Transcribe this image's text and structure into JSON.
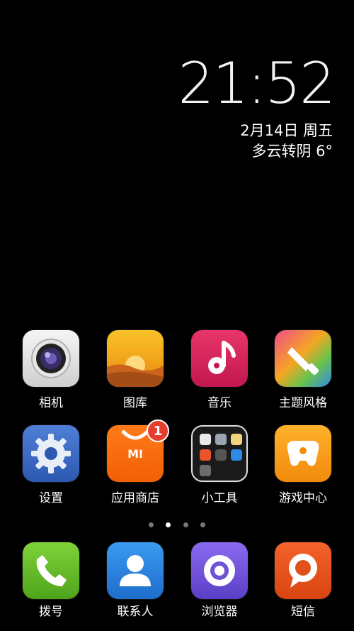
{
  "clock": {
    "time": "21:52",
    "date": "2月14日 周五",
    "weather": "多云转阴 6°"
  },
  "apps_row1": [
    {
      "label": "相机",
      "icon": "camera-icon"
    },
    {
      "label": "图库",
      "icon": "gallery-icon"
    },
    {
      "label": "音乐",
      "icon": "music-icon"
    },
    {
      "label": "主题风格",
      "icon": "themes-icon"
    }
  ],
  "apps_row2": [
    {
      "label": "设置",
      "icon": "settings-icon"
    },
    {
      "label": "应用商店",
      "icon": "app-store-icon",
      "badge": "1"
    },
    {
      "label": "小工具",
      "icon": "tools-folder-icon"
    },
    {
      "label": "游戏中心",
      "icon": "game-center-icon"
    }
  ],
  "dock": [
    {
      "label": "拨号",
      "icon": "phone-icon"
    },
    {
      "label": "联系人",
      "icon": "contacts-icon"
    },
    {
      "label": "浏览器",
      "icon": "browser-icon"
    },
    {
      "label": "短信",
      "icon": "messages-icon"
    }
  ],
  "page_indicator": {
    "count": 4,
    "active": 1
  },
  "icon_text": {
    "mi": "MI"
  }
}
